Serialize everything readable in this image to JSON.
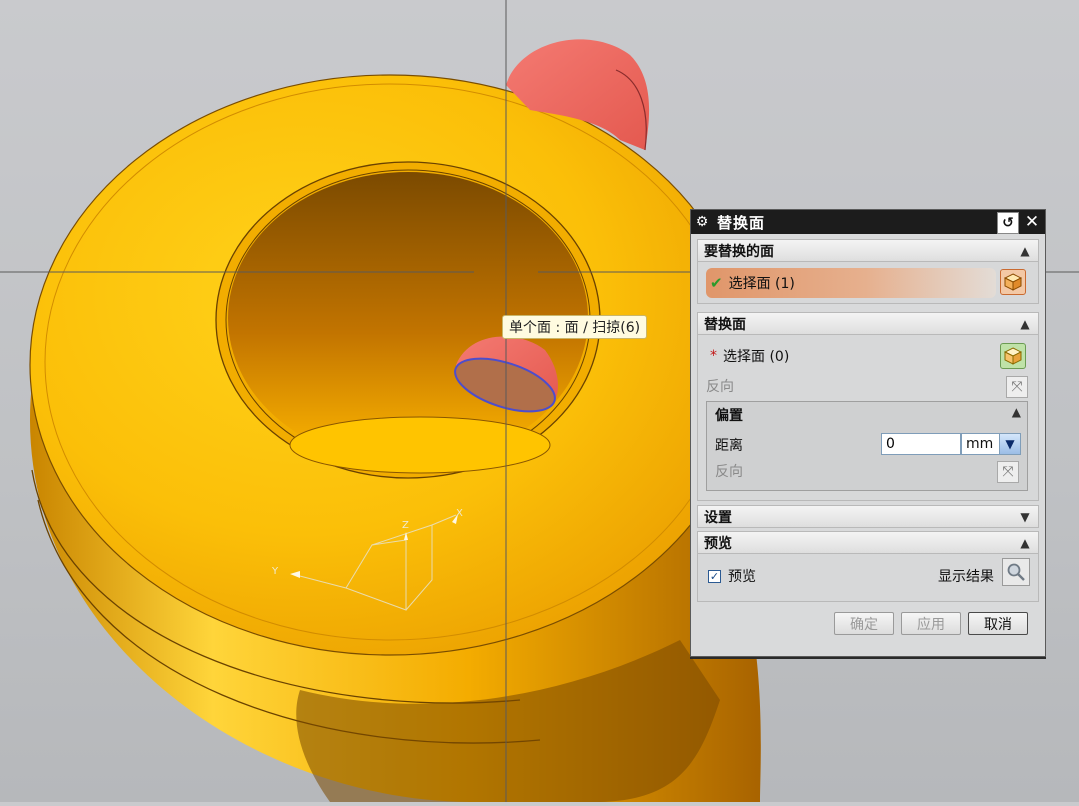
{
  "viewport": {
    "tooltip": "单个面 : 面 / 扫掠(6)",
    "colors": {
      "part": "#f5b400",
      "highlight": "#f07070",
      "background": "#c5c7ca"
    },
    "triad_labels": {
      "x": "X",
      "y": "Y",
      "z": "Z"
    }
  },
  "dialog": {
    "title": "替换面",
    "icons": {
      "gear": "gear-icon",
      "reset": "reset-icon",
      "close": "close-icon"
    },
    "section_target": {
      "header": "要替换的面",
      "select_label": "选择面 (1)"
    },
    "section_replacement": {
      "header": "替换面",
      "select_label": "选择面 (0)",
      "reverse_label": "反向",
      "offset": {
        "header": "偏置",
        "distance_label": "距离",
        "distance_value": "0",
        "unit": "mm",
        "reverse_label": "反向"
      }
    },
    "section_settings": {
      "header": "设置"
    },
    "section_preview": {
      "header": "预览",
      "preview_label": "预览",
      "preview_checked": true,
      "show_result_label": "显示结果"
    },
    "buttons": {
      "ok": "确定",
      "apply": "应用",
      "cancel": "取消"
    }
  }
}
